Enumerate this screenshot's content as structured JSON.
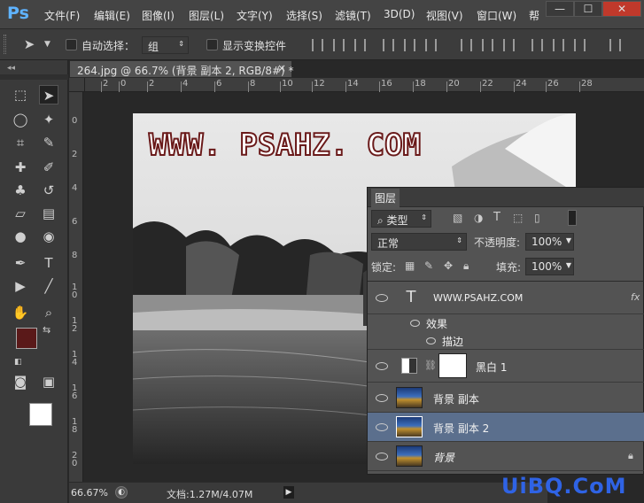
{
  "app": {
    "logo": "Ps"
  },
  "menubar": {
    "items": [
      "文件(F)",
      "编辑(E)",
      "图像(I)",
      "图层(L)",
      "文字(Y)",
      "选择(S)",
      "滤镜(T)",
      "3D(D)",
      "视图(V)",
      "窗口(W)",
      "帮"
    ],
    "window_buttons": [
      "—",
      "☐",
      "✕"
    ]
  },
  "options": {
    "auto_select_label": "自动选择：",
    "auto_select_value": "组",
    "show_transform_label": "显示变换控件"
  },
  "document": {
    "tab_title": "264.jpg @ 66.7% (背景 副本 2, RGB/8#) *",
    "tab_close": "×",
    "zoom": "66.67%",
    "doc_size": "文档:1.27M/4.07M"
  },
  "rulers": {
    "h_ticks": [
      "2",
      "0",
      "2",
      "4",
      "6",
      "8",
      "10",
      "12",
      "14",
      "16",
      "18",
      "20",
      "22",
      "24",
      "26",
      "28"
    ],
    "v_ticks": [
      "0",
      "2",
      "4",
      "6",
      "8",
      "1\n0",
      "1\n2",
      "1\n4",
      "1\n6",
      "1\n8",
      "2\n0"
    ]
  },
  "canvas_text": "WWW. PSAHZ. COM",
  "colors": {
    "foreground": "#5a1919",
    "background": "#ffffff",
    "selected_layer": "#5b6f8d"
  },
  "layers_panel": {
    "title": "图层",
    "filter_type": "类型",
    "blend_mode": "正常",
    "opacity_label": "不透明度:",
    "opacity_value": "100%",
    "lock_label": "锁定:",
    "fill_label": "填充:",
    "fill_value": "100%",
    "layers": [
      {
        "name": "WWW.PSAHZ.COM",
        "kind": "text",
        "badge": "fx"
      },
      {
        "name": "效果",
        "kind": "effects"
      },
      {
        "name": "描边",
        "kind": "effect"
      },
      {
        "name": "黑白 1",
        "kind": "adjustment"
      },
      {
        "name": "背景 副本",
        "kind": "image"
      },
      {
        "name": "背景 副本 2",
        "kind": "image",
        "selected": true
      },
      {
        "name": "背景",
        "kind": "image",
        "locked": true
      }
    ]
  },
  "watermark": "UiBQ.CoM"
}
